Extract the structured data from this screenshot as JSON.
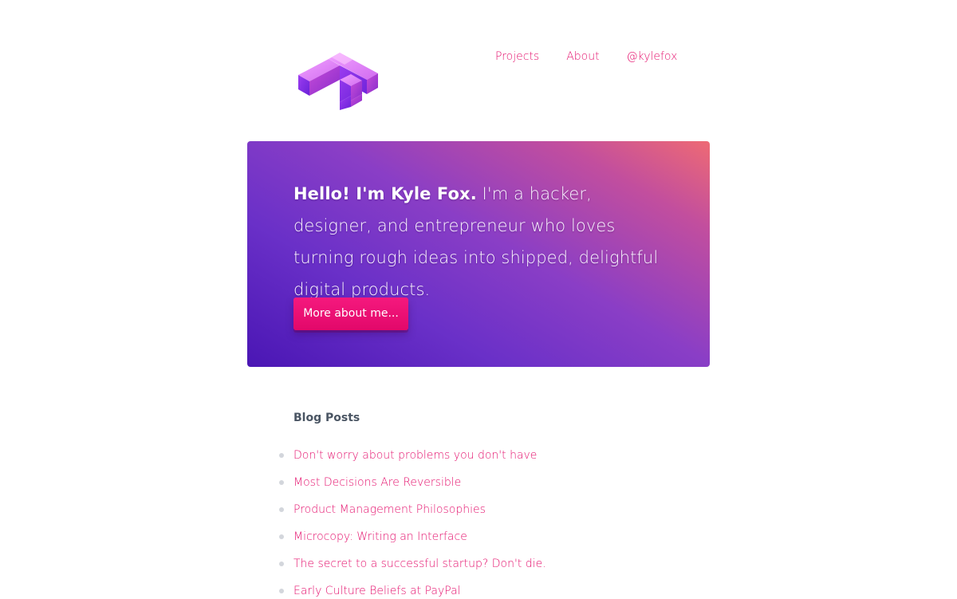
{
  "brand": {
    "logo_icon": "isometric-f-logo-icon",
    "accent_color": "#e5146f"
  },
  "nav": {
    "projects": "Projects",
    "about": "About",
    "twitter": "@kylefox"
  },
  "hero": {
    "bold_intro": "Hello! I'm Kyle Fox.",
    "body": " I'm a hacker, designer, and entrepreneur who loves turning rough ideas into shipped, delightful digital products.",
    "button_label": "More about me...",
    "gradient_start": "#4a16b4",
    "gradient_end": "#ee6a74"
  },
  "blog": {
    "heading": "Blog Posts",
    "posts": [
      {
        "title": "Don't worry about problems you don't have"
      },
      {
        "title": "Most Decisions Are Reversible"
      },
      {
        "title": "Product Management Philosophies"
      },
      {
        "title": "Microcopy: Writing an Interface"
      },
      {
        "title": "The secret to a successful startup? Don't die."
      },
      {
        "title": "Early Culture Beliefs at PayPal"
      }
    ]
  }
}
